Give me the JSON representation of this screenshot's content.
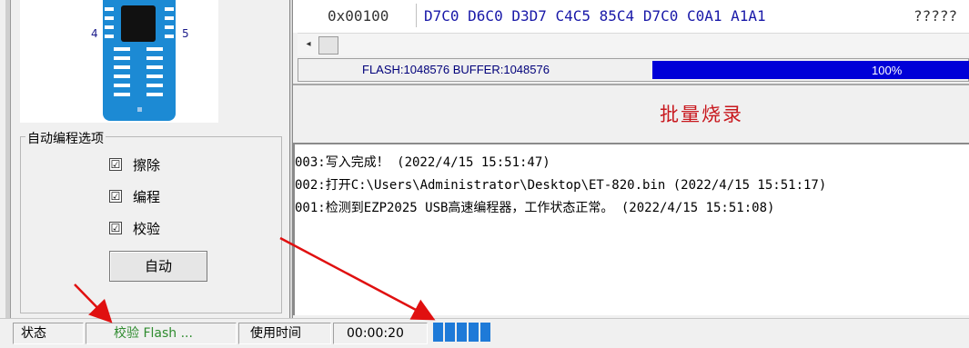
{
  "chip": {
    "pin_left": "4",
    "pin_right": "5"
  },
  "auto_options": {
    "title": "自动编程选项",
    "checkboxes": [
      {
        "label": "擦除",
        "checked": true
      },
      {
        "label": "编程",
        "checked": true
      },
      {
        "label": "校验",
        "checked": true
      }
    ],
    "check_mark": "☑",
    "auto_button": "自动"
  },
  "hex_view": {
    "address": "0x00100",
    "bytes": "D7C0 D6C0 D3D7 C4C5 85C4 D7C0 C0A1 A1A1",
    "ascii": "?????"
  },
  "scroll": {
    "left_arrow": "◂"
  },
  "flash_info": "FLASH:1048576 BUFFER:1048576",
  "progress": {
    "value": 1.0,
    "label": "100%"
  },
  "batch_label": "批量烧录",
  "log": [
    "003:写入完成！ (2022/4/15 15:51:47)",
    "002:打开C:\\Users\\Administrator\\Desktop\\ET-820.bin (2022/4/15 15:51:17)",
    "001:检测到EZP2025 USB高速编程器，工作状态正常。 (2022/4/15 15:51:08)"
  ],
  "status_bar": {
    "status_label": "状态",
    "status_value": "校验 Flash ...",
    "elapsed_label": "使用时间",
    "elapsed_value": "00:00:20",
    "segments_filled": 5
  },
  "colors": {
    "accent": "#0000d8",
    "batch_red": "#c8181e",
    "status_green": "#2e8b2e",
    "arrow_red": "#e01010"
  }
}
